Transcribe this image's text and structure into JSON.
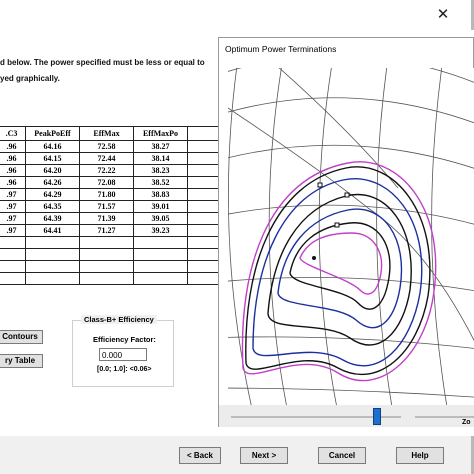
{
  "window": {
    "close_glyph": "✕"
  },
  "instructions": {
    "line1": "d below. The power specified must be less or equal to",
    "line2": "yed graphically."
  },
  "table": {
    "headers": [
      ".C3",
      "PeakPoEff",
      "EffMax",
      "EffMaxPo"
    ],
    "rows": [
      [
        ".96",
        "64.16",
        "72.58",
        "38.27"
      ],
      [
        ".96",
        "64.15",
        "72.44",
        "38.14"
      ],
      [
        ".96",
        "64.20",
        "72.22",
        "38.23"
      ],
      [
        ".96",
        "64.26",
        "72.08",
        "38.52"
      ],
      [
        ".97",
        "64.29",
        "71.80",
        "38.83"
      ],
      [
        ".97",
        "64.35",
        "71.57",
        "39.01"
      ],
      [
        ".97",
        "64.39",
        "71.39",
        "39.05"
      ],
      [
        ".97",
        "64.41",
        "71.27",
        "39.23"
      ],
      [
        "",
        "",
        "",
        ""
      ],
      [
        "",
        "",
        "",
        ""
      ],
      [
        "",
        "",
        "",
        ""
      ],
      [
        "",
        "",
        "",
        ""
      ]
    ]
  },
  "buttons": {
    "contours": "Contours",
    "table": "ry Table",
    "back": "< Back",
    "next": "Next >",
    "cancel": "Cancel",
    "help": "Help"
  },
  "efficiency": {
    "group_title": "Class-B+ Efficiency",
    "factor_label": "Efficiency Factor:",
    "factor_value": "0.000",
    "range": "[0.0; 1.0]: <0.06>"
  },
  "plot": {
    "title": "Optimum Power Terminations",
    "zoom_label": "Zo",
    "slider_level": 0.86,
    "colors": {
      "black": "#111111",
      "blue": "#1c2fa0",
      "magenta": "#c040c8",
      "grid": "#555555"
    }
  }
}
